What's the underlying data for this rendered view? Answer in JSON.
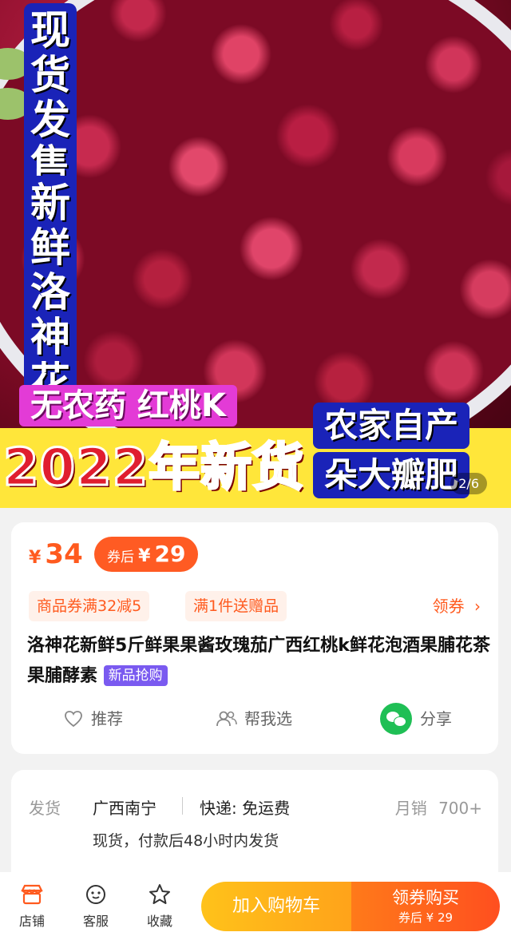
{
  "banner": {
    "vertical_1": "现货发售",
    "vertical_2": "新鲜洛神花",
    "tag_magenta": "无农药 红桃K",
    "tag_blue_1": "农家自产",
    "tag_blue_2": "朵大瓣肥",
    "year_text": "2022年新货",
    "pager": "2/6"
  },
  "price": {
    "currency": "¥",
    "amount": "34",
    "coupon_prefix": "券后",
    "coupon_currency": "¥",
    "coupon_amount": "29"
  },
  "chips": [
    "商品券满32减5",
    "满1件送赠品"
  ],
  "get_coupon": "领券",
  "product": {
    "title": "洛神花新鲜5斤鲜果果酱玫瑰茄广西红桃k鲜花泡酒果脯花茶果脯酵素",
    "badge": "新品抢购"
  },
  "actions": {
    "recommend": "推荐",
    "help_choose": "帮我选",
    "share": "分享"
  },
  "shipping": {
    "label": "发货",
    "origin": "广西南宁",
    "express": "快递: 免运费",
    "monthly_sales_label": "月销",
    "monthly_sales_value": "700+",
    "note": "现货，付款后48小时内发货"
  },
  "bottom": {
    "store": "店铺",
    "service": "客服",
    "favorite": "收藏",
    "add_cart": "加入购物车",
    "buy_label": "领券购买",
    "buy_sub": "券后 ¥ 29"
  },
  "colors": {
    "accent": "#ff5a1e",
    "banner_blue": "#1a23b8",
    "banner_yellow": "#ffe63a",
    "new_badge": "#7a5af0",
    "wechat_green": "#1fbf55"
  }
}
